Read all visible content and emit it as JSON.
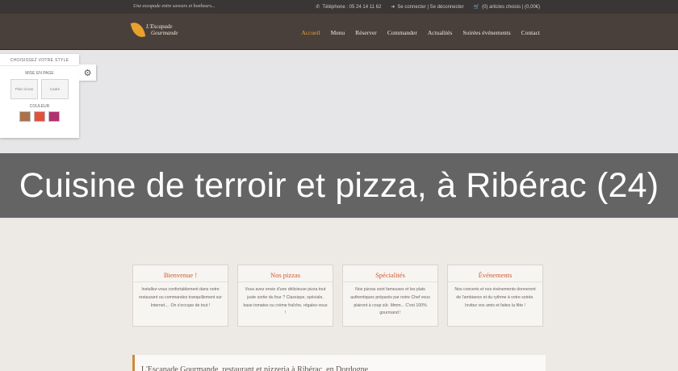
{
  "topbar": {
    "tagline": "Une escapade entre saveurs et bonheurs...",
    "phone": "Téléphone : 05 24 14 11 62",
    "login": "Se connecter | Se déconnecter",
    "cart": "(0) articles choisis | (0,00€)"
  },
  "logo": {
    "line1": "L'Escapade",
    "line2": "Gourmande"
  },
  "menu": [
    {
      "label": "Accueil",
      "active": true
    },
    {
      "label": "Menu"
    },
    {
      "label": "Réserver"
    },
    {
      "label": "Commander"
    },
    {
      "label": "Actualités"
    },
    {
      "label": "Soirées événements"
    },
    {
      "label": "Contact"
    }
  ],
  "style_panel": {
    "title": "CHOISISSEZ VOTRE STYLE",
    "layout_heading": "MISE EN PAGE",
    "layout_options": [
      "Plein écran",
      "Cadre"
    ],
    "color_heading": "COULEUR",
    "colors": [
      "#a8734a",
      "#e0523c",
      "#b2306e"
    ]
  },
  "hero": {
    "caption": "Cuisine de terroir et pizza, à Ribérac (24)"
  },
  "features": [
    {
      "title": "Bienvenue !",
      "text": "Installez-vous confortablement dans notre restaurant ou commandez tranquillement sur Internet.... On s'occupe de tout !"
    },
    {
      "title": "Nos pizzas",
      "text": "Vous avez envie d'une délicieuse pizza tout juste sortie du four ? Classique, spéciale, base tomates ou crème fraîche, régalez-vous !"
    },
    {
      "title": "Spécialités",
      "text": "Nos pizzas sont fameuses et les plats authentiques préparés par notre Chef vous plairont à coup sûr. Mmm... C'est 100% gourmand !"
    },
    {
      "title": "Événements",
      "text": "Nos concerts et nos événements donneront de l'ambiance et du rythme à votre soirée. Invitez vos amis et faites la fête !"
    }
  ],
  "article": {
    "title": "L'Escapade Gourmande, restaurant et pizzeria à Ribérac, en Dordogne"
  },
  "theme": {
    "brand_orange": "#e8a12a",
    "heading_red": "#d2572e",
    "nav_bg": "#4a403b"
  }
}
